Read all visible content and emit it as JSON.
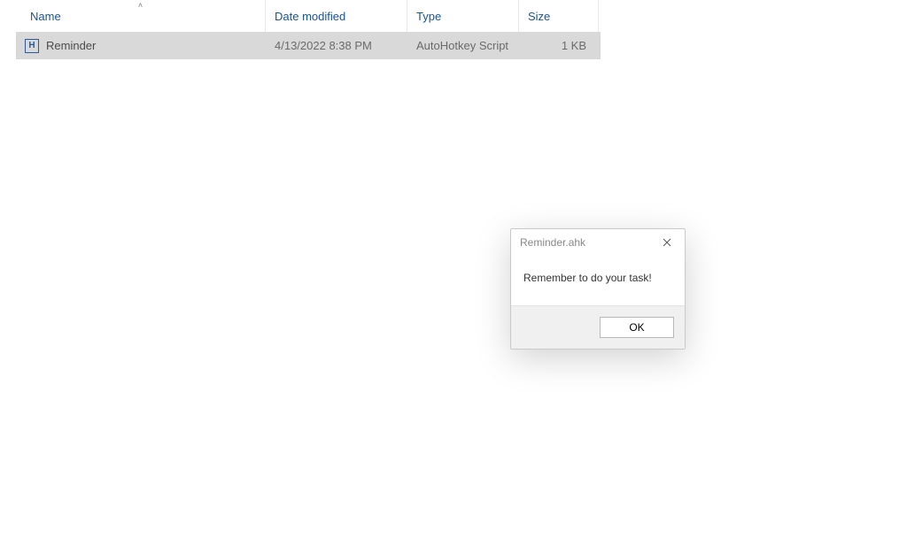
{
  "columns": {
    "name": "Name",
    "date": "Date modified",
    "type": "Type",
    "size": "Size"
  },
  "files": [
    {
      "icon_letter": "H",
      "name": "Reminder",
      "date": "4/13/2022 8:38 PM",
      "type": "AutoHotkey Script",
      "size": "1 KB"
    }
  ],
  "dialog": {
    "title": "Reminder.ahk",
    "message": "Remember to do your task!",
    "ok_label": "OK"
  }
}
